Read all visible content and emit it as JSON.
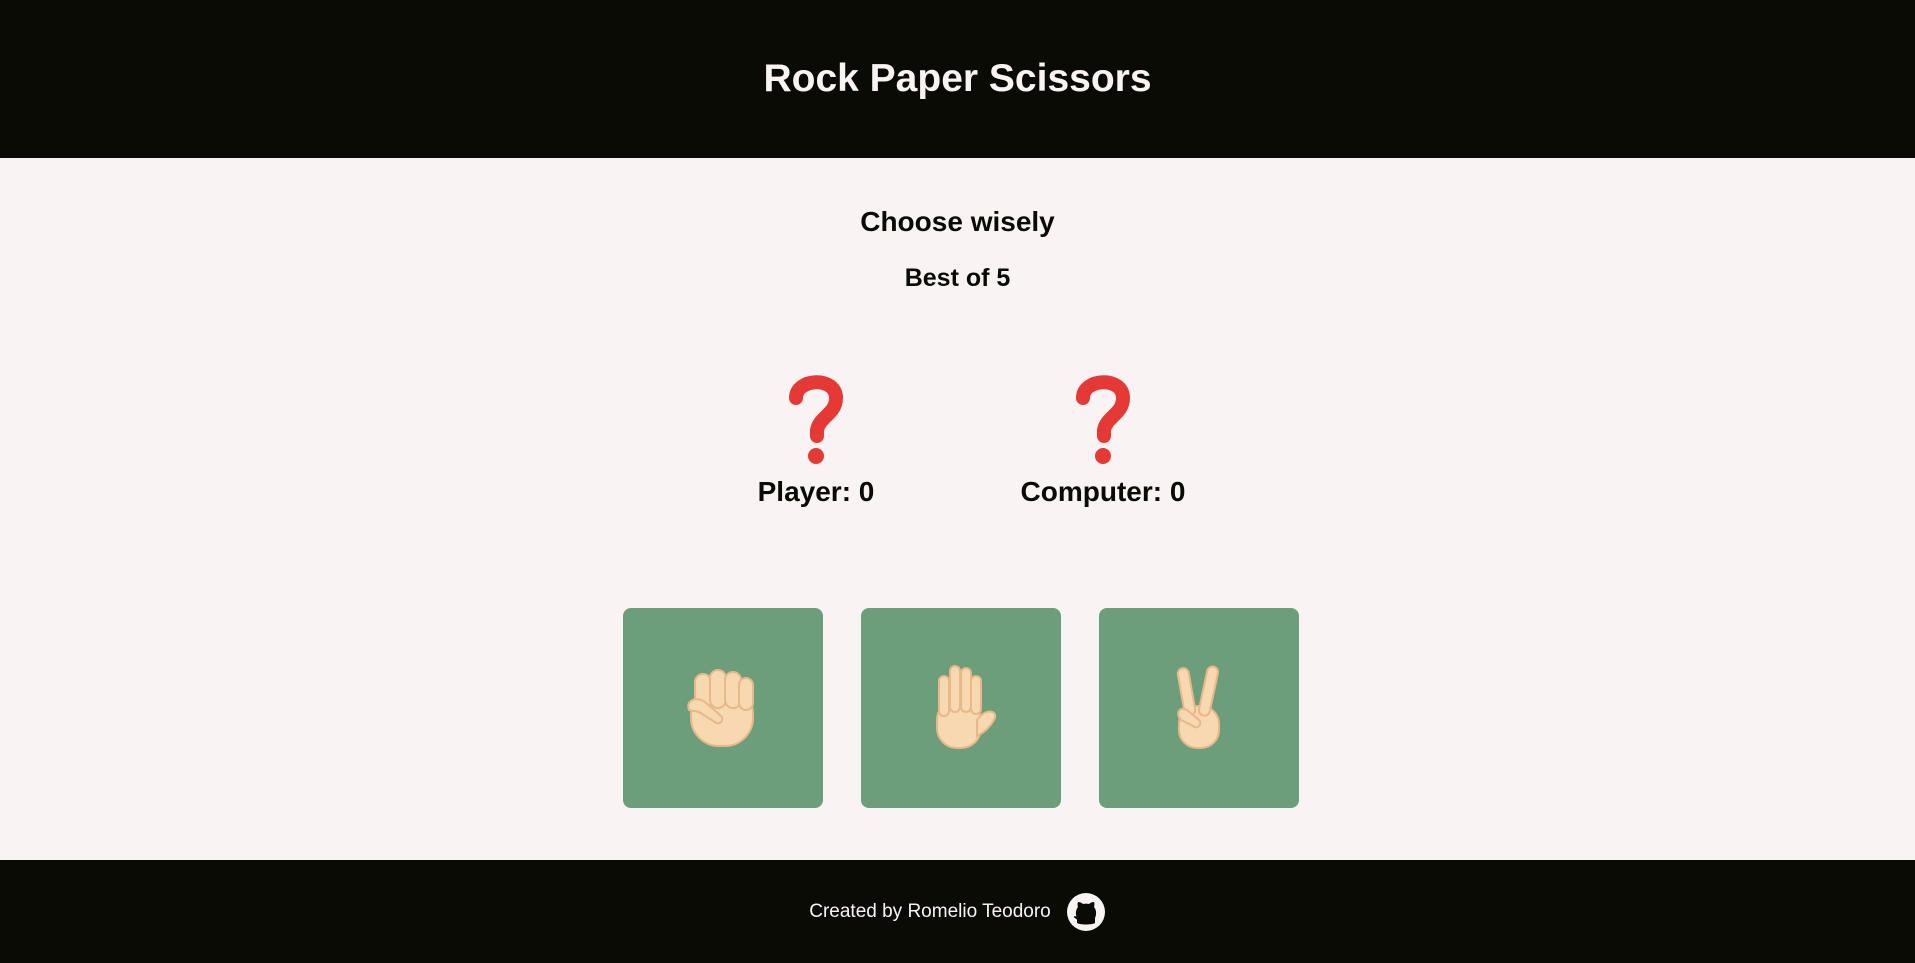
{
  "header": {
    "title": "Rock Paper Scissors"
  },
  "main": {
    "prompt": "Choose wisely",
    "round_info": "Best of 5"
  },
  "scoreboard": {
    "player": {
      "label": "Player: 0",
      "sign_icon": "question-mark-icon"
    },
    "computer": {
      "label": "Computer: 0",
      "sign_icon": "question-mark-icon"
    }
  },
  "choices": [
    {
      "name": "rock",
      "icon": "raised-fist-icon"
    },
    {
      "name": "paper",
      "icon": "raised-hand-icon"
    },
    {
      "name": "scissors",
      "icon": "victory-hand-icon"
    }
  ],
  "footer": {
    "credit": "Created by Romelio Teodoro",
    "link_icon": "github-icon"
  },
  "colors": {
    "header_bg": "#0a0b05",
    "page_bg": "#f9f3f3",
    "button_bg": "#6c9e7c",
    "question_red": "#e53935",
    "skin": "#f7d8b0"
  }
}
